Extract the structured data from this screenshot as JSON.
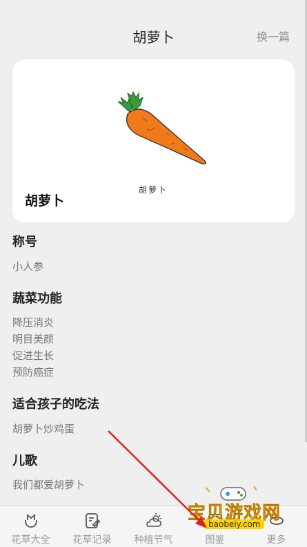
{
  "header": {
    "title": "胡萝卜",
    "switch_label": "换一篇"
  },
  "card": {
    "name": "胡萝卜",
    "image_caption": "胡萝卜"
  },
  "sections": [
    {
      "title": "称号",
      "items": [
        "小人参"
      ]
    },
    {
      "title": "蔬菜功能",
      "items": [
        "降压消炎",
        "明目美颜",
        "促进生长",
        "预防癌症"
      ]
    },
    {
      "title": "适合孩子的吃法",
      "items": [
        "胡萝卜炒鸡蛋"
      ]
    },
    {
      "title": "儿歌",
      "items": [
        "我们都爱胡萝卜"
      ]
    }
  ],
  "tabs": [
    {
      "label": "花草大全",
      "icon": "flower-icon"
    },
    {
      "label": "花草记录",
      "icon": "note-edit-icon"
    },
    {
      "label": "种植节气",
      "icon": "weather-cloud-icon"
    },
    {
      "label": "图鉴",
      "icon": "gallery-icon"
    },
    {
      "label": "更多",
      "icon": "more-icon"
    }
  ],
  "watermark": {
    "text": "宝贝游戏网",
    "url": "baobeiy.com"
  },
  "colors": {
    "background": "#efefef",
    "card": "#ffffff",
    "carrot": "#f07a1a",
    "leaf": "#3b9a3b",
    "arrow": "#e02020",
    "watermark": "#f0a800"
  }
}
